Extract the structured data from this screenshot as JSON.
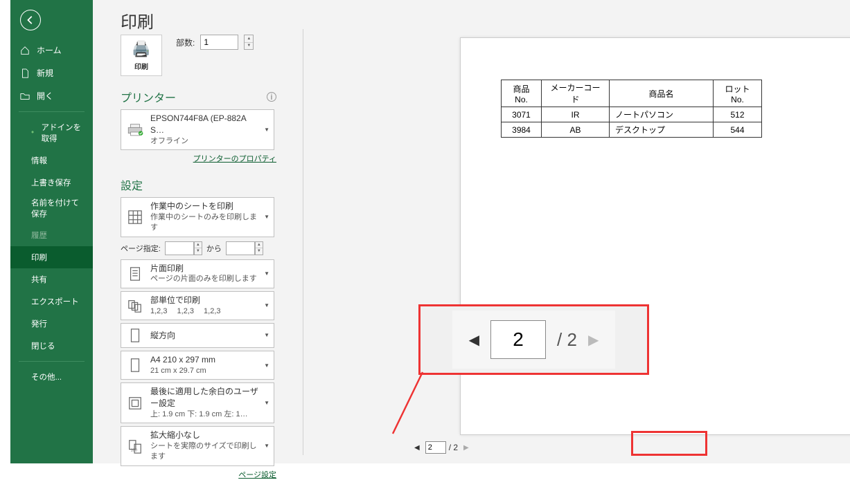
{
  "title": "印刷",
  "sidebar": {
    "home": "ホーム",
    "new": "新規",
    "open": "開く",
    "addin": "アドインを取得",
    "info": "情報",
    "save": "上書き保存",
    "saveas": "名前を付けて保存",
    "history": "履歴",
    "print": "印刷",
    "share": "共有",
    "export": "エクスポート",
    "publish": "発行",
    "close": "閉じる",
    "other": "その他..."
  },
  "print_button_label": "印刷",
  "copies_label": "部数:",
  "copies_value": "1",
  "printer_header": "プリンター",
  "printer": {
    "name": "EPSON744F8A (EP-882A S…",
    "status": "オフライン"
  },
  "printer_properties_link": "プリンターのプロパティ",
  "settings_header": "設定",
  "settings": {
    "scope": {
      "title": "作業中のシートを印刷",
      "sub": "作業中のシートのみを印刷します"
    },
    "page_range_label": "ページ指定:",
    "page_range_to": "から",
    "duplex": {
      "title": "片面印刷",
      "sub": "ページの片面のみを印刷します"
    },
    "collate": {
      "title": "部単位で印刷",
      "sub": "1,2,3　 1,2,3　 1,2,3"
    },
    "orientation": {
      "title": "縦方向"
    },
    "paper": {
      "title": "A4 210 x 297 mm",
      "sub": "21 cm x 29.7 cm"
    },
    "margins": {
      "title": "最後に適用した余白のユーザー設定",
      "sub": "上: 1.9 cm 下: 1.9 cm 左: 1…"
    },
    "scale": {
      "title": "拡大縮小なし",
      "sub": "シートを実際のサイズで印刷します"
    },
    "page_setup_link": "ページ設定"
  },
  "preview": {
    "headers": [
      "商品No.",
      "メーカーコード",
      "商品名",
      "ロットNo."
    ],
    "rows": [
      [
        "3071",
        "IR",
        "ノートパソコン",
        "512"
      ],
      [
        "3984",
        "AB",
        "デスクトップ",
        "544"
      ]
    ]
  },
  "pagenav": {
    "current": "2",
    "total_label": "/ 2"
  },
  "callout": {
    "current": "2",
    "total_label": "/ 2"
  }
}
